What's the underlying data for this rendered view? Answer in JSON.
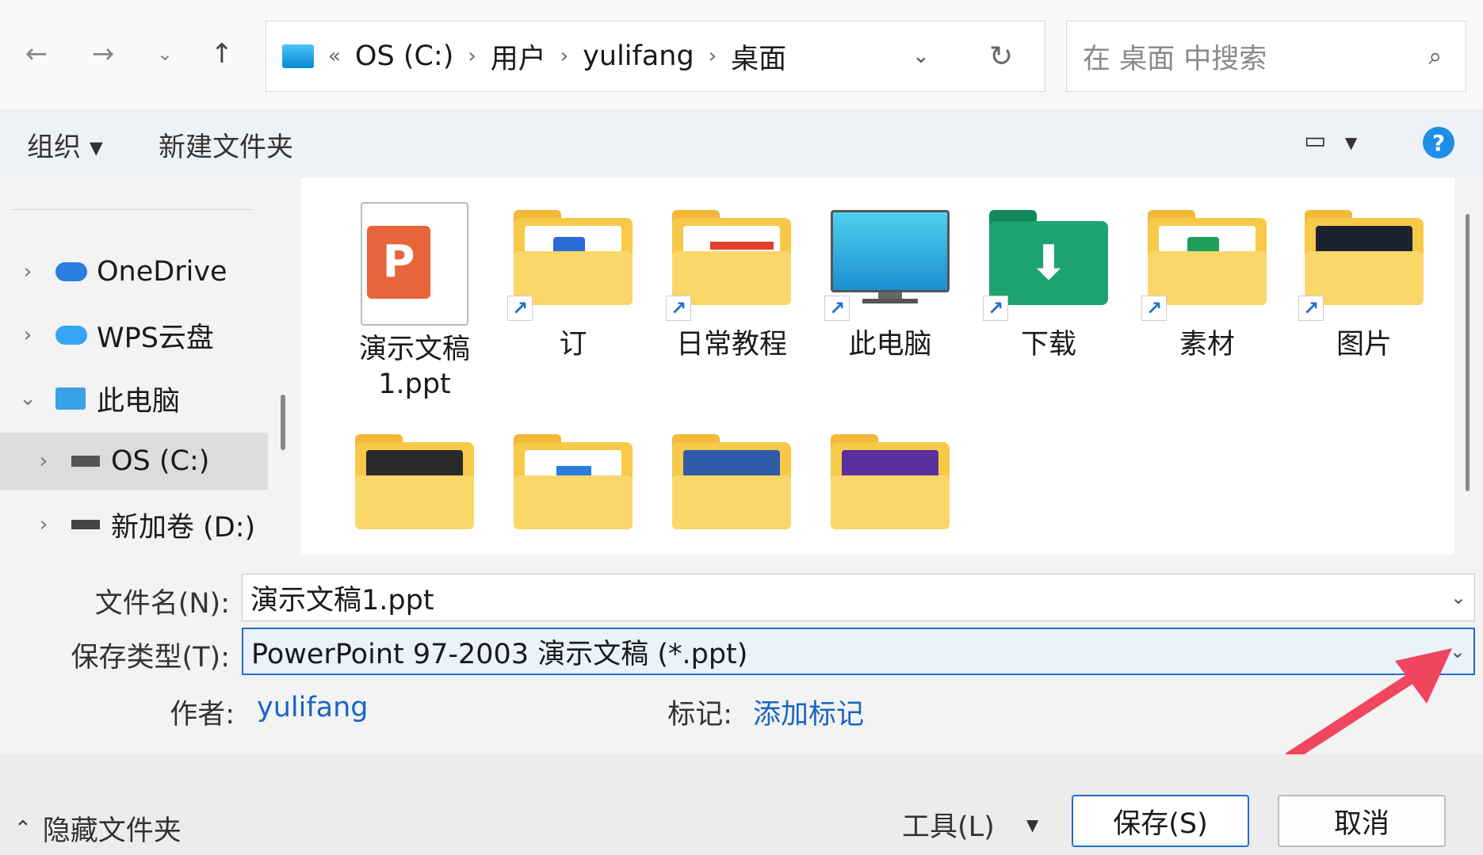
{
  "address": {
    "crumbs": [
      "OS (C:)",
      "用户",
      "yulifang",
      "桌面"
    ],
    "overflow": "«",
    "search_placeholder": "在 桌面 中搜索"
  },
  "toolbar": {
    "organize": "组织 ▾",
    "new_folder": "新建文件夹"
  },
  "nav": {
    "items": [
      {
        "label": "OneDrive",
        "icon": "cloud-icon"
      },
      {
        "label": "WPS云盘",
        "icon": "cloud-icon"
      },
      {
        "label": "此电脑",
        "icon": "computer-icon"
      },
      {
        "label": "OS (C:)",
        "icon": "drive-icon"
      },
      {
        "label": "新加卷 (D:)",
        "icon": "drive-icon"
      }
    ]
  },
  "files": [
    {
      "label": "演示文稿\n1.ppt",
      "icon": "ppt-file-icon"
    },
    {
      "label": "订",
      "icon": "folder-icon"
    },
    {
      "label": "日常教程",
      "icon": "folder-icon"
    },
    {
      "label": "此电脑",
      "icon": "monitor-icon"
    },
    {
      "label": "下载",
      "icon": "download-folder-icon"
    },
    {
      "label": "素材",
      "icon": "folder-icon"
    },
    {
      "label": "图片",
      "icon": "folder-icon"
    }
  ],
  "form": {
    "filename_label": "文件名(N):",
    "filename_value": "演示文稿1.ppt",
    "type_label": "保存类型(T):",
    "type_value": "PowerPoint 97-2003 演示文稿 (*.ppt)",
    "author_label": "作者:",
    "author_value": "yulifang",
    "tags_label": "标记:",
    "tags_value": "添加标记"
  },
  "footer": {
    "hide_folders": "隐藏文件夹",
    "tools": "工具(L)",
    "save": "保存(S)",
    "cancel": "取消"
  },
  "colors": {
    "accent": "#1f6fc4",
    "arrow": "#f0475e",
    "folder": "#f7c948"
  }
}
